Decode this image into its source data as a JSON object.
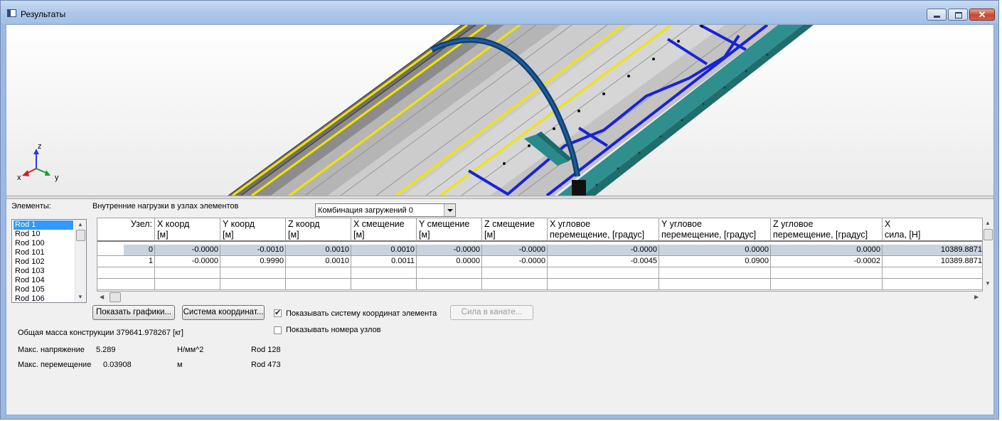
{
  "window": {
    "title": "Результаты"
  },
  "viewport": {
    "axes": {
      "x": "x",
      "y": "y",
      "z": "z"
    }
  },
  "panel": {
    "elements_label": "Элементы:",
    "internal_loads_label": "Внутренние нагрузки в узлах элементов",
    "combination": {
      "selected": "Комбинация загружений 0"
    }
  },
  "elements": [
    "Rod 1",
    "Rod 10",
    "Rod 100",
    "Rod 101",
    "Rod 102",
    "Rod 103",
    "Rod 104",
    "Rod 105",
    "Rod 106"
  ],
  "table": {
    "headers": [
      [
        "Узел:",
        ""
      ],
      [
        "X коорд",
        "[м]"
      ],
      [
        "Y коорд",
        "[м]"
      ],
      [
        "Z коорд",
        "[м]"
      ],
      [
        "X смещение",
        "[м]"
      ],
      [
        "Y смещение",
        "[м]"
      ],
      [
        "Z смещение",
        "[м]"
      ],
      [
        "X угловое",
        "перемещение, [градус]"
      ],
      [
        "Y угловое",
        "перемещение, [градус]"
      ],
      [
        "Z угловое",
        "перемещение, [градус]"
      ],
      [
        "X",
        "сила, [Н]"
      ]
    ],
    "rows": [
      [
        "0",
        "-0.0000",
        "-0.0010",
        "0.0010",
        "0.0010",
        "-0.0000",
        "-0.0000",
        "-0.0000",
        "0.0000",
        "0.0000",
        "10389.8871"
      ],
      [
        "1",
        "-0.0000",
        "0.9990",
        "0.0010",
        "0.0011",
        "0.0000",
        "-0.0000",
        "-0.0045",
        "0.0900",
        "-0.0002",
        "10389.8871"
      ]
    ]
  },
  "buttons": {
    "show_graphs": "Показать графики...",
    "coord_system": "Система координат...",
    "rope_force": "Сила в канате..."
  },
  "checkboxes": {
    "show_coord_system": {
      "label": "Показывать систему координат элемента",
      "checked": true
    },
    "show_node_numbers": {
      "label": "Показывать номера узлов",
      "checked": false
    }
  },
  "summary": {
    "total_mass": "Общая масса конструкции  379641.978267 [кг]",
    "max_stress_label": "Макс. напряжение",
    "max_stress_value": "5.289",
    "max_stress_unit": "Н/мм^2",
    "max_stress_rod": "Rod 128",
    "max_disp_label": "Макс. перемещение",
    "max_disp_value": "0.03908",
    "max_disp_unit": "м",
    "max_disp_rod": "Rod 473"
  }
}
